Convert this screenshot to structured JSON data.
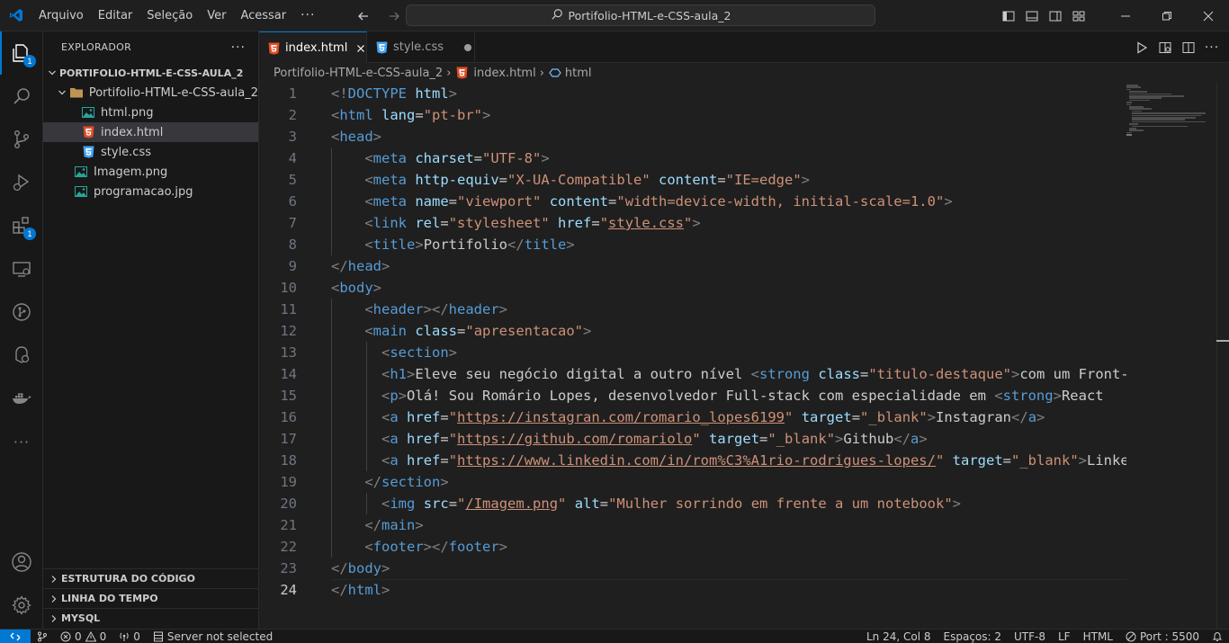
{
  "titlebar": {
    "menu": [
      "Arquivo",
      "Editar",
      "Seleção",
      "Ver",
      "Acessar"
    ],
    "more": "···",
    "search_text": "Portifolio-HTML-e-CSS-aula_2"
  },
  "activity": {
    "explorer_badge": "1",
    "extensions_badge": "1",
    "more": "···"
  },
  "sidebar": {
    "title": "EXPLORADOR",
    "more": "···",
    "root": "PORTIFOLIO-HTML-E-CSS-AULA_2",
    "folder": "Portifolio-HTML-e-CSS-aula_2",
    "files_in_folder": [
      {
        "name": "html.png",
        "icon": "image-icon"
      },
      {
        "name": "index.html",
        "icon": "html-icon"
      },
      {
        "name": "style.css",
        "icon": "css-icon"
      }
    ],
    "root_files": [
      {
        "name": "Imagem.png",
        "icon": "image-icon"
      },
      {
        "name": "programacao.jpg",
        "icon": "image-icon"
      }
    ],
    "sections": [
      "ESTRUTURA DO CÓDIGO",
      "LINHA DO TEMPO",
      "MYSQL"
    ]
  },
  "tabs": [
    {
      "label": "index.html",
      "active": true
    },
    {
      "label": "style.css",
      "active": false,
      "dirty": true
    }
  ],
  "breadcrumb": {
    "folder": "Portifolio-HTML-e-CSS-aula_2",
    "file": "index.html",
    "symbol": "html"
  },
  "editor": {
    "current_line": 24,
    "line_numbers": [
      "1",
      "2",
      "3",
      "4",
      "5",
      "6",
      "7",
      "8",
      "9",
      "10",
      "11",
      "12",
      "13",
      "14",
      "15",
      "16",
      "17",
      "18",
      "19",
      "20",
      "21",
      "22",
      "23",
      "24"
    ]
  },
  "statusbar": {
    "server": "Server not selected",
    "errors": "0",
    "warnings": "0",
    "ports": "0",
    "cursor": "Ln 24, Col 8",
    "spaces": "Espaços: 2",
    "encoding": "UTF-8",
    "eol": "LF",
    "language": "HTML",
    "port": "Port : 5500"
  },
  "colors": {
    "accent": "#0078d4",
    "tag": "#569cd6",
    "attribute": "#9cdcfe",
    "string": "#ce9178",
    "html_icon": "#e44d26",
    "css_icon": "#42a5f5",
    "image_icon": "#26a69a"
  }
}
